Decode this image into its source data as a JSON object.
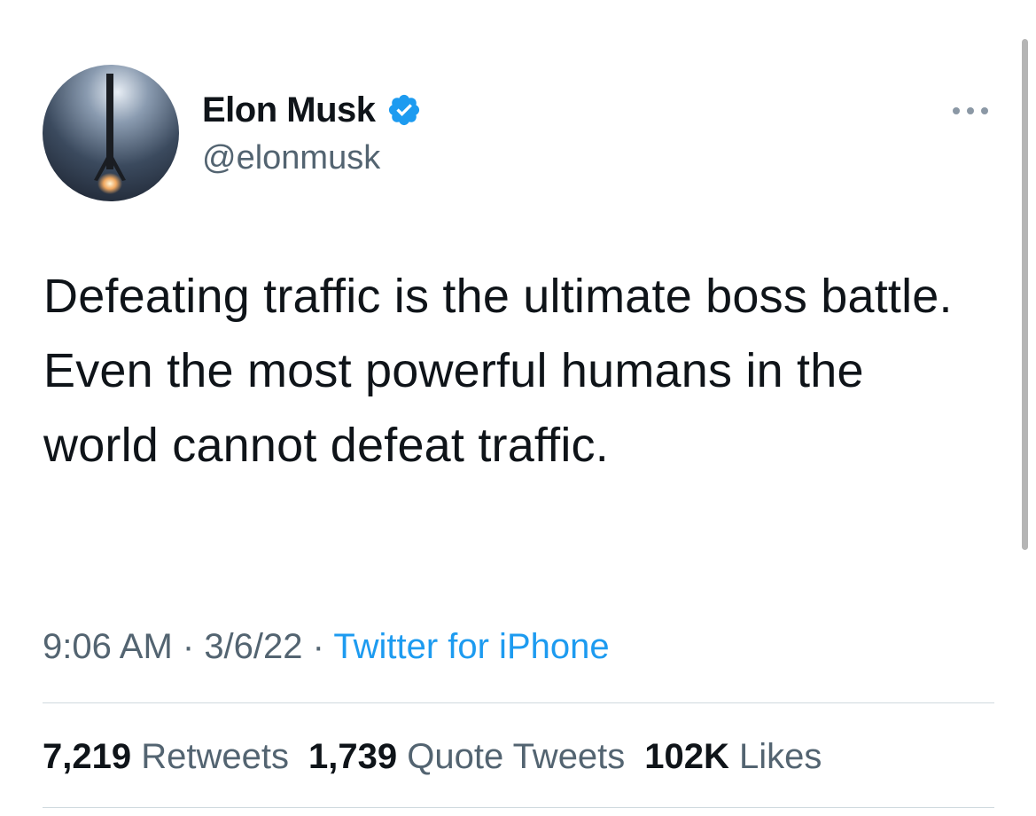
{
  "author": {
    "display_name": "Elon Musk",
    "handle": "@elonmusk",
    "verified_icon": "verified-badge-icon",
    "avatar_icon": "rocket-booster-avatar"
  },
  "more_icon": "ellipsis-icon",
  "tweet": {
    "text": "Defeating traffic is the ultimate boss battle. Even the most powerful humans in the world cannot defeat traffic."
  },
  "meta": {
    "time": "9:06 AM",
    "separator_1": " · ",
    "date": "3/6/22",
    "separator_2": " · ",
    "source": "Twitter for iPhone"
  },
  "stats": {
    "retweets_count": "7,219",
    "retweets_label": "Retweets",
    "quote_tweets_count": "1,739",
    "quote_tweets_label": "Quote Tweets",
    "likes_count": "102K",
    "likes_label": "Likes"
  },
  "colors": {
    "accent": "#1d9bf0",
    "secondary_text": "#536471",
    "primary_text": "#0f1419",
    "divider": "#cfd9de"
  }
}
